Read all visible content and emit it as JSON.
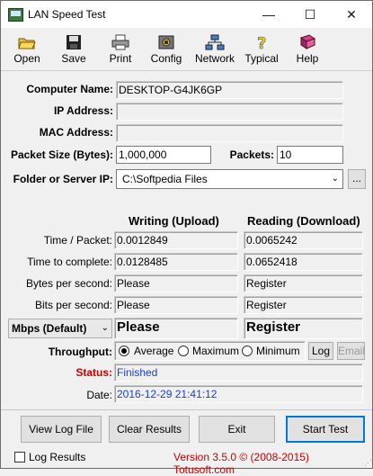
{
  "window": {
    "title": "LAN Speed Test",
    "minimize": "—",
    "maximize": "☐",
    "close": "✕"
  },
  "toolbar": [
    {
      "id": "open",
      "label": "Open",
      "icon": "folder-open-icon"
    },
    {
      "id": "save",
      "label": "Save",
      "icon": "floppy-disk-icon"
    },
    {
      "id": "print",
      "label": "Print",
      "icon": "printer-icon"
    },
    {
      "id": "config",
      "label": "Config",
      "icon": "config-icon"
    },
    {
      "id": "network",
      "label": "Network",
      "icon": "network-icon"
    },
    {
      "id": "typical",
      "label": "Typical",
      "icon": "question-icon"
    },
    {
      "id": "help",
      "label": "Help",
      "icon": "help-book-icon"
    }
  ],
  "info": {
    "computer_name_label": "Computer Name:",
    "computer_name_value": "DESKTOP-G4JK6GP",
    "ip_label": "IP Address:",
    "ip_value": "",
    "mac_label": "MAC Address:",
    "mac_value": "",
    "packet_size_label": "Packet Size (Bytes):",
    "packet_size_value": "1,000,000",
    "packets_label": "Packets:",
    "packets_value": "10",
    "folder_label": "Folder or Server IP:",
    "folder_value": "C:\\Softpedia Files",
    "browse_label": "..."
  },
  "results": {
    "writing_header": "Writing (Upload)",
    "reading_header": "Reading (Download)",
    "rows": [
      {
        "label": "Time / Packet:",
        "write": "0.0012849",
        "read": "0.0065242"
      },
      {
        "label": "Time to complete:",
        "write": "0.0128485",
        "read": "0.0652418"
      },
      {
        "label": "Bytes per second:",
        "write": "Please",
        "read": "Register"
      },
      {
        "label": "Bits per second:",
        "write": "Please",
        "read": "Register"
      }
    ],
    "unit_select": "Mbps (Default)",
    "big_write": "Please",
    "big_read": "Register"
  },
  "throughput": {
    "label": "Throughput:",
    "options": [
      "Average",
      "Maximum",
      "Minimum"
    ],
    "selected": "Average",
    "log_button": "Log",
    "email_button": "Email"
  },
  "status": {
    "label": "Status:",
    "value": "Finished",
    "color": "#cc0000"
  },
  "date": {
    "label": "Date:",
    "value": "2016-12-29 21:41:12"
  },
  "buttons": {
    "view_log": "View Log File",
    "clear": "Clear Results",
    "exit": "Exit",
    "start": "Start Test"
  },
  "footer": {
    "log_results_label": "Log Results",
    "version": "Version 3.5.0  © (2008-2015) Totusoft.com",
    "version_color": "#cc0000"
  }
}
